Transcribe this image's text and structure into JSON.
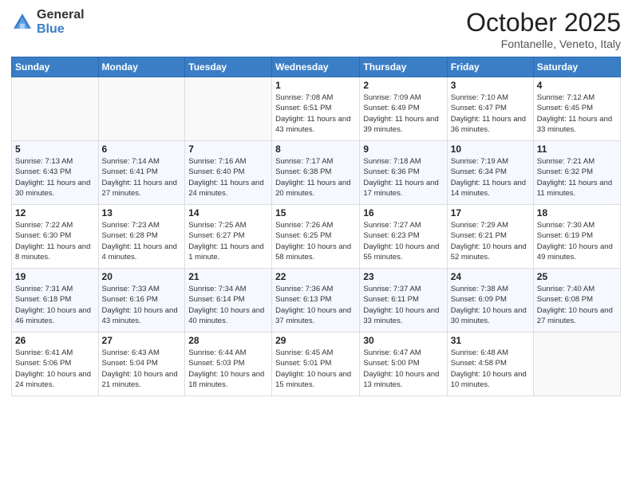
{
  "logo": {
    "general": "General",
    "blue": "Blue"
  },
  "header": {
    "month": "October 2025",
    "location": "Fontanelle, Veneto, Italy"
  },
  "days_of_week": [
    "Sunday",
    "Monday",
    "Tuesday",
    "Wednesday",
    "Thursday",
    "Friday",
    "Saturday"
  ],
  "weeks": [
    [
      {
        "day": "",
        "info": ""
      },
      {
        "day": "",
        "info": ""
      },
      {
        "day": "",
        "info": ""
      },
      {
        "day": "1",
        "info": "Sunrise: 7:08 AM\nSunset: 6:51 PM\nDaylight: 11 hours and 43 minutes."
      },
      {
        "day": "2",
        "info": "Sunrise: 7:09 AM\nSunset: 6:49 PM\nDaylight: 11 hours and 39 minutes."
      },
      {
        "day": "3",
        "info": "Sunrise: 7:10 AM\nSunset: 6:47 PM\nDaylight: 11 hours and 36 minutes."
      },
      {
        "day": "4",
        "info": "Sunrise: 7:12 AM\nSunset: 6:45 PM\nDaylight: 11 hours and 33 minutes."
      }
    ],
    [
      {
        "day": "5",
        "info": "Sunrise: 7:13 AM\nSunset: 6:43 PM\nDaylight: 11 hours and 30 minutes."
      },
      {
        "day": "6",
        "info": "Sunrise: 7:14 AM\nSunset: 6:41 PM\nDaylight: 11 hours and 27 minutes."
      },
      {
        "day": "7",
        "info": "Sunrise: 7:16 AM\nSunset: 6:40 PM\nDaylight: 11 hours and 24 minutes."
      },
      {
        "day": "8",
        "info": "Sunrise: 7:17 AM\nSunset: 6:38 PM\nDaylight: 11 hours and 20 minutes."
      },
      {
        "day": "9",
        "info": "Sunrise: 7:18 AM\nSunset: 6:36 PM\nDaylight: 11 hours and 17 minutes."
      },
      {
        "day": "10",
        "info": "Sunrise: 7:19 AM\nSunset: 6:34 PM\nDaylight: 11 hours and 14 minutes."
      },
      {
        "day": "11",
        "info": "Sunrise: 7:21 AM\nSunset: 6:32 PM\nDaylight: 11 hours and 11 minutes."
      }
    ],
    [
      {
        "day": "12",
        "info": "Sunrise: 7:22 AM\nSunset: 6:30 PM\nDaylight: 11 hours and 8 minutes."
      },
      {
        "day": "13",
        "info": "Sunrise: 7:23 AM\nSunset: 6:28 PM\nDaylight: 11 hours and 4 minutes."
      },
      {
        "day": "14",
        "info": "Sunrise: 7:25 AM\nSunset: 6:27 PM\nDaylight: 11 hours and 1 minute."
      },
      {
        "day": "15",
        "info": "Sunrise: 7:26 AM\nSunset: 6:25 PM\nDaylight: 10 hours and 58 minutes."
      },
      {
        "day": "16",
        "info": "Sunrise: 7:27 AM\nSunset: 6:23 PM\nDaylight: 10 hours and 55 minutes."
      },
      {
        "day": "17",
        "info": "Sunrise: 7:29 AM\nSunset: 6:21 PM\nDaylight: 10 hours and 52 minutes."
      },
      {
        "day": "18",
        "info": "Sunrise: 7:30 AM\nSunset: 6:19 PM\nDaylight: 10 hours and 49 minutes."
      }
    ],
    [
      {
        "day": "19",
        "info": "Sunrise: 7:31 AM\nSunset: 6:18 PM\nDaylight: 10 hours and 46 minutes."
      },
      {
        "day": "20",
        "info": "Sunrise: 7:33 AM\nSunset: 6:16 PM\nDaylight: 10 hours and 43 minutes."
      },
      {
        "day": "21",
        "info": "Sunrise: 7:34 AM\nSunset: 6:14 PM\nDaylight: 10 hours and 40 minutes."
      },
      {
        "day": "22",
        "info": "Sunrise: 7:36 AM\nSunset: 6:13 PM\nDaylight: 10 hours and 37 minutes."
      },
      {
        "day": "23",
        "info": "Sunrise: 7:37 AM\nSunset: 6:11 PM\nDaylight: 10 hours and 33 minutes."
      },
      {
        "day": "24",
        "info": "Sunrise: 7:38 AM\nSunset: 6:09 PM\nDaylight: 10 hours and 30 minutes."
      },
      {
        "day": "25",
        "info": "Sunrise: 7:40 AM\nSunset: 6:08 PM\nDaylight: 10 hours and 27 minutes."
      }
    ],
    [
      {
        "day": "26",
        "info": "Sunrise: 6:41 AM\nSunset: 5:06 PM\nDaylight: 10 hours and 24 minutes."
      },
      {
        "day": "27",
        "info": "Sunrise: 6:43 AM\nSunset: 5:04 PM\nDaylight: 10 hours and 21 minutes."
      },
      {
        "day": "28",
        "info": "Sunrise: 6:44 AM\nSunset: 5:03 PM\nDaylight: 10 hours and 18 minutes."
      },
      {
        "day": "29",
        "info": "Sunrise: 6:45 AM\nSunset: 5:01 PM\nDaylight: 10 hours and 15 minutes."
      },
      {
        "day": "30",
        "info": "Sunrise: 6:47 AM\nSunset: 5:00 PM\nDaylight: 10 hours and 13 minutes."
      },
      {
        "day": "31",
        "info": "Sunrise: 6:48 AM\nSunset: 4:58 PM\nDaylight: 10 hours and 10 minutes."
      },
      {
        "day": "",
        "info": ""
      }
    ]
  ]
}
